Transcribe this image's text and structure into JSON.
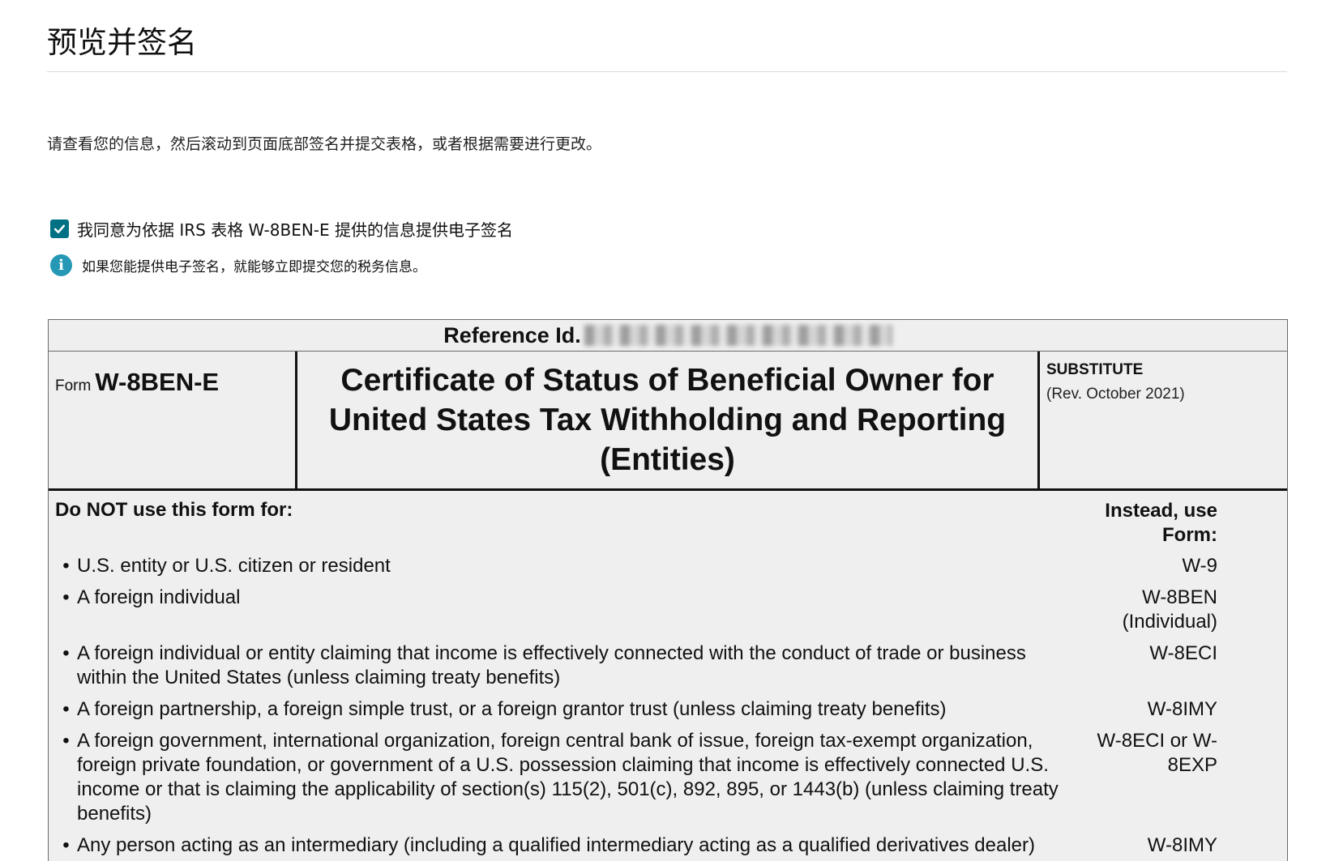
{
  "page": {
    "title": "预览并签名",
    "instructions": "请查看您的信息，然后滚动到页面底部签名并提交表格，或者根据需要进行更改。"
  },
  "consent": {
    "label": "我同意为依据 IRS 表格 W-8BEN-E 提供的信息提供电子签名",
    "checked": true,
    "info": "如果您能提供电子签名，就能够立即提交您的税务信息。"
  },
  "form": {
    "reference_label": "Reference Id.",
    "form_word": "Form",
    "form_number": "W-8BEN-E",
    "heading": "Certificate of Status of Beneficial Owner for United States Tax Withholding and Reporting (Entities)",
    "substitute": "SUBSTITUTE",
    "revision": "(Rev. October 2021)",
    "do_not_use": "Do NOT use this form for:",
    "instead_use": "Instead, use Form:",
    "bullet": "•",
    "items": [
      {
        "text": "U.S. entity or U.S. citizen or resident",
        "form": "W-9"
      },
      {
        "text": "A foreign individual",
        "form": "W-8BEN (Individual)"
      },
      {
        "text": "A foreign individual or entity claiming that income is effectively connected with the conduct of trade or business within the United States (unless claiming treaty benefits)",
        "form": "W-8ECI"
      },
      {
        "text": "A foreign partnership, a foreign simple trust, or a foreign grantor trust (unless claiming treaty benefits)",
        "form": "W-8IMY"
      },
      {
        "text": "A foreign government, international organization, foreign central bank of issue, foreign tax-exempt organization, foreign private foundation, or government of a U.S. possession claiming that income is effectively connected U.S. income or that is claiming the applicability of section(s) 115(2), 501(c), 892, 895, or 1443(b) (unless claiming treaty benefits)",
        "form": "W-8ECI or W-8EXP"
      },
      {
        "text": "Any person acting as an intermediary (including a qualified intermediary acting as a qualified derivatives dealer)",
        "form": "W-8IMY"
      }
    ]
  },
  "colors": {
    "checkbox": "#007185",
    "info_icon": "#2598b5"
  }
}
